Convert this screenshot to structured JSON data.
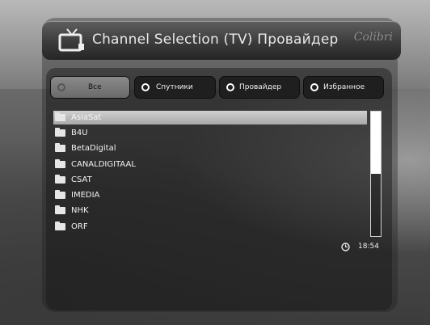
{
  "header": {
    "title": "Channel Selection  (TV) Провайдер",
    "logo_text": "Colibri"
  },
  "filters": [
    {
      "label": "Все",
      "selected": true
    },
    {
      "label": "Спутники",
      "selected": false
    },
    {
      "label": "Провайдер",
      "selected": false
    },
    {
      "label": "Избранное",
      "selected": false
    }
  ],
  "providers": [
    {
      "name": "AsiaSat",
      "highlighted": true
    },
    {
      "name": "B4U"
    },
    {
      "name": "BetaDigital"
    },
    {
      "name": "CANALDIGITAAL"
    },
    {
      "name": "CSAT"
    },
    {
      "name": "IMEDIA"
    },
    {
      "name": "NHK"
    },
    {
      "name": "ORF"
    }
  ],
  "scrollbar": {
    "position_fraction": 0.0,
    "visible_fraction": 0.5
  },
  "status": {
    "time": "18:54"
  },
  "icons": {
    "title": "tv-icon",
    "folder": "folder-icon",
    "clock": "clock-icon"
  },
  "colors": {
    "highlight": "#bdbdbd",
    "button": "#1f1f1f",
    "text": "#f0f0f0"
  }
}
